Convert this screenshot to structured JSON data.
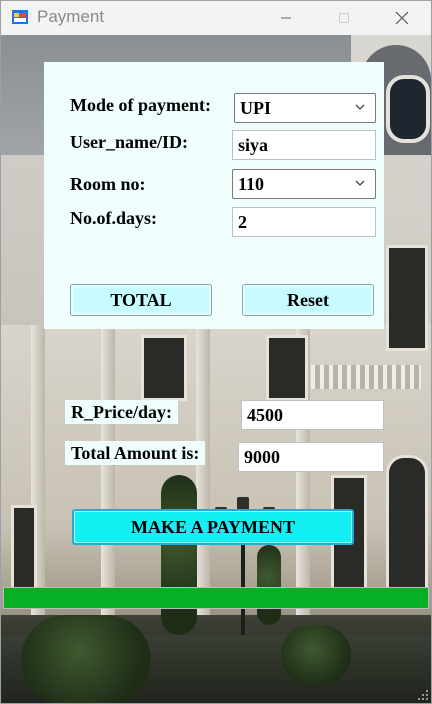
{
  "window": {
    "title": "Payment"
  },
  "form": {
    "mode_label": "Mode of payment:",
    "mode_value": "UPI",
    "user_label": "User_name/ID:",
    "user_value": "siya",
    "room_label": "Room no:",
    "room_value": "110",
    "days_label": "No.of.days:",
    "days_value": "2",
    "total_button": "TOTAL",
    "reset_button": "Reset"
  },
  "summary": {
    "price_label": "R_Price/day:",
    "price_value": "4500",
    "amount_label": "Total Amount is:",
    "amount_value": "9000"
  },
  "payment": {
    "button_label": "MAKE A PAYMENT",
    "progress_fraction": 1.0
  },
  "colors": {
    "panel_bg": "#effdfd",
    "button_bg": "#c6fbff",
    "pay_button_bg": "#13f0f3",
    "progress_fill": "#06b025"
  },
  "icons": {
    "app": "windows-forms-app-icon",
    "dropdown": "chevron-down-icon",
    "minimize": "minimize-icon",
    "maximize": "maximize-icon",
    "close": "close-icon"
  }
}
